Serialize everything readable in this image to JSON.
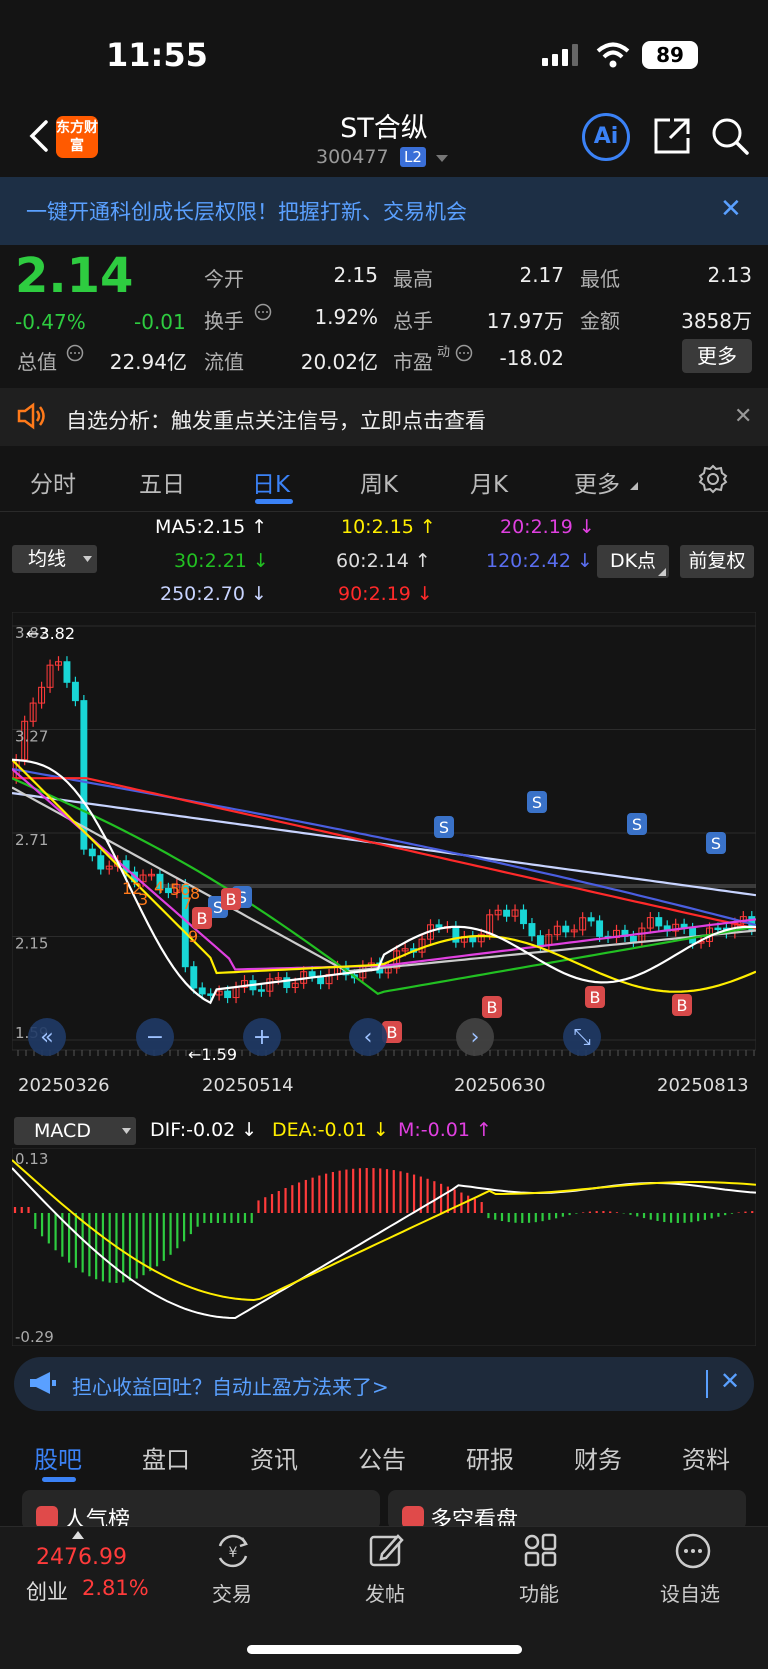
{
  "status": {
    "time": "11:55",
    "battery": "89"
  },
  "header": {
    "title": "ST合纵",
    "code": "300477",
    "level": "L2",
    "logo": "东方财富",
    "ai": "Ai"
  },
  "banner": {
    "text": "一键开通科创成长层权限！把握打新、交易机会"
  },
  "quote": {
    "price": "2.14",
    "change_pct": "-0.47%",
    "change": "-0.01",
    "open_label": "今开",
    "open": "2.15",
    "high_label": "最高",
    "high": "2.17",
    "low_label": "最低",
    "low": "2.13",
    "turnover_label": "换手",
    "turnover": "1.92%",
    "volume_label": "总手",
    "volume": "17.97万",
    "amount_label": "金额",
    "amount": "3858万",
    "mktcap_label": "总值",
    "mktcap": "22.94亿",
    "float_label": "流值",
    "float": "20.02亿",
    "pe_label": "市盈",
    "pe_sup": "动",
    "pe": "-18.02",
    "more": "更多"
  },
  "analysis": {
    "text": "自选分析：触发重点关注信号，立即点击查看"
  },
  "tabs": [
    "分时",
    "五日",
    "日K",
    "周K",
    "月K",
    "更多"
  ],
  "ma": {
    "button": "均线",
    "ma5": "MA5:2.15",
    "ma10": "10:2.15",
    "ma20": "20:2.19",
    "ma30": "30:2.21",
    "ma60": "60:2.14",
    "ma120": "120:2.42",
    "ma250": "250:2.70",
    "ma90": "90:2.19",
    "dk": "DK点",
    "fq": "前复权",
    "colors": {
      "ma5": "#ffffff",
      "ma10": "#ffee00",
      "ma20": "#e040e0",
      "ma30": "#22c022",
      "ma60": "#cccccc",
      "ma120": "#4a5ee0",
      "ma250": "#c8d4ff",
      "ma90": "#ff2a2a"
    }
  },
  "chart_data": [
    {
      "type": "candlestick",
      "yticks": [
        "3.82",
        "3.27",
        "2.71",
        "2.15",
        "1.59"
      ],
      "annotations": {
        "high_label": "3.82",
        "low_label": "1.59"
      },
      "x_dates": [
        "20250326",
        "20250514",
        "20250630",
        "20250813"
      ],
      "signal_digits": [
        "12",
        "3",
        "4",
        "56",
        "7",
        "8",
        "9"
      ],
      "signals": {
        "sell": [
          "S",
          "S",
          "S",
          "S",
          "S",
          "S"
        ],
        "buy": [
          "B",
          "B",
          "B",
          "B",
          "B",
          "B"
        ]
      }
    },
    {
      "type": "macd",
      "button": "MACD",
      "dif": "DIF:-0.02",
      "dea": "DEA:-0.01",
      "m": "M:-0.01",
      "yticks": [
        "0.13",
        "-0.29"
      ]
    }
  ],
  "promo": {
    "text": "担心收益回吐？自动止盈方法来了>"
  },
  "bottom_tabs": [
    "股吧",
    "盘口",
    "资讯",
    "公告",
    "研报",
    "财务",
    "资料"
  ],
  "cards": [
    "人气榜",
    "多空看盘"
  ],
  "nav": {
    "index_value": "2476.99",
    "index_name": "创业",
    "index_pct": "2.81%",
    "items": [
      "交易",
      "发帖",
      "功能",
      "设自选"
    ]
  }
}
